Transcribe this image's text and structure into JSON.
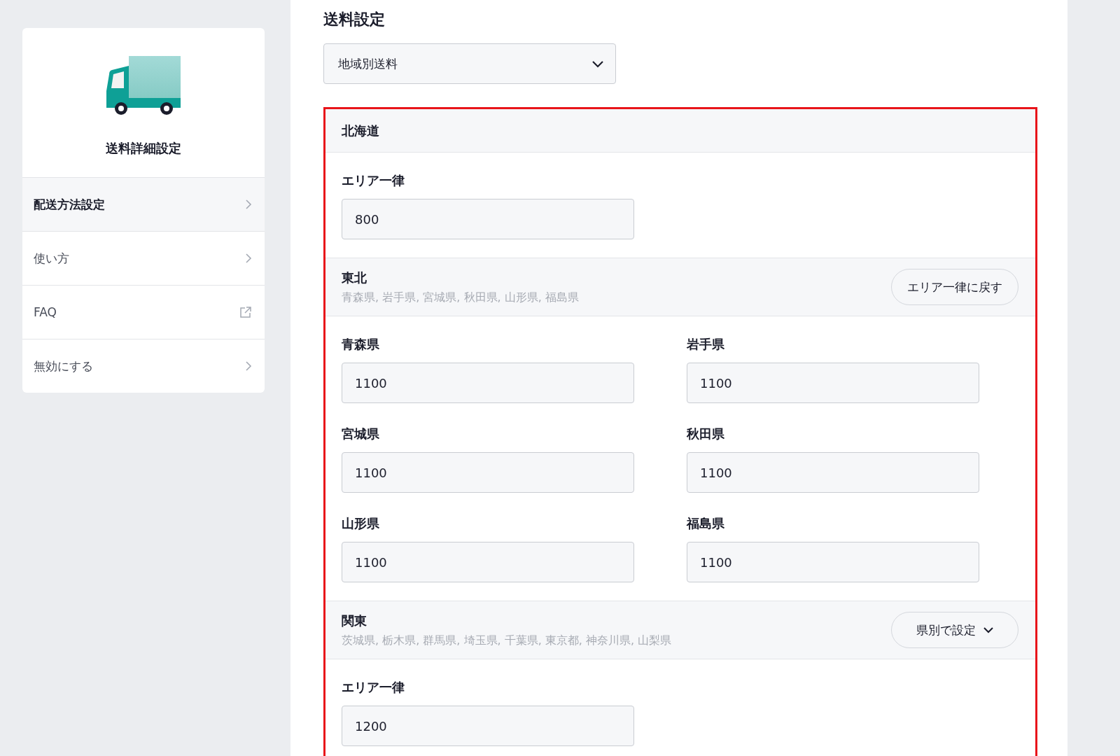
{
  "sidebar": {
    "title": "送料詳細設定",
    "items": [
      {
        "label": "配送方法設定",
        "kind": "chevron",
        "selected": true
      },
      {
        "label": "使い方",
        "kind": "chevron",
        "selected": false
      },
      {
        "label": "FAQ",
        "kind": "external",
        "selected": false
      },
      {
        "label": "無効にする",
        "kind": "chevron",
        "selected": false
      }
    ]
  },
  "main": {
    "title": "送料設定",
    "select": {
      "value": "地域別送料"
    },
    "regions": [
      {
        "name": "北海道",
        "fields": [
          {
            "label": "エリア一律",
            "value": "800"
          }
        ]
      },
      {
        "name": "東北",
        "prefectures": "青森県, 岩手県, 宮城県, 秋田県, 山形県, 福島県",
        "button": {
          "label": "エリア一律に戻す",
          "kind": "plain"
        },
        "fields": [
          {
            "label": "青森県",
            "value": "1100"
          },
          {
            "label": "岩手県",
            "value": "1100"
          },
          {
            "label": "宮城県",
            "value": "1100"
          },
          {
            "label": "秋田県",
            "value": "1100"
          },
          {
            "label": "山形県",
            "value": "1100"
          },
          {
            "label": "福島県",
            "value": "1100"
          }
        ]
      },
      {
        "name": "関東",
        "prefectures": "茨城県, 栃木県, 群馬県, 埼玉県, 千葉県, 東京都, 神奈川県, 山梨県",
        "button": {
          "label": "県別で設定",
          "kind": "dropdown"
        },
        "fields": [
          {
            "label": "エリア一律",
            "value": "1200"
          }
        ]
      }
    ]
  }
}
